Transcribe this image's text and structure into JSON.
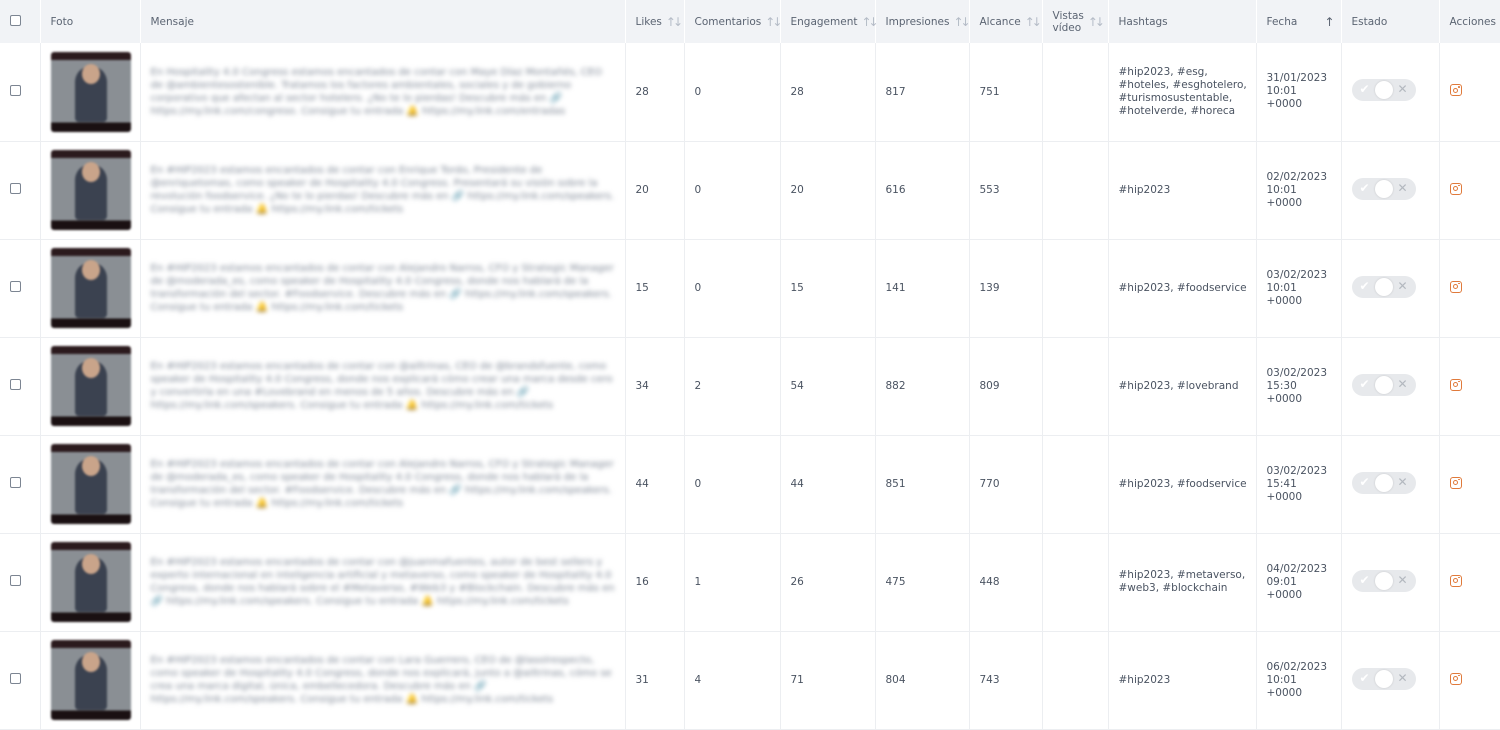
{
  "table": {
    "headers": {
      "foto": "Foto",
      "mensaje": "Mensaje",
      "likes": "Likes",
      "comentarios": "Comentarios",
      "engagement": "Engagement",
      "impresiones": "Impresiones",
      "alcance": "Alcance",
      "vistas_video": "Vistas vídeo",
      "hashtags": "Hashtags",
      "fecha": "Fecha",
      "estado": "Estado",
      "acciones": "Acciones"
    },
    "sort_icon": "↑↓",
    "sort_active_icon": "↑↓",
    "rows": [
      {
        "message": "En Hospitality 4.0 Congress estamos encantados de contar con Maye Díaz Montañés, CEO de @ambientesostenible. Tratamos los factores ambientales, sociales y de gobierno corporativo que afectan al sector hotelero. ¿No te lo pierdas! Descubre más en 🔗 https://my.link.com/congreso. Consigue tu entrada 🔔 https://my.link.com/entradas",
        "likes": "28",
        "comentarios": "0",
        "engagement": "28",
        "impresiones": "817",
        "alcance": "751",
        "vistas_video": "",
        "hashtags": "#hip2023, #esg, #hoteles, #esghotelero, #turismosustentable, #hotelverde, #horeca",
        "fecha": "31/01/2023 10:01 +0000"
      },
      {
        "message": "En #HIP2023 estamos encantados de contar con Enrique Tordo, Presidente de @enriquetomas, como speaker de Hospitality 4.0 Congress. Presentará su visión sobre la revolución foodservice. ¿No te lo pierdas! Descubre más en 🔗 https://my.link.com/speakers. Consigue tu entrada 🔔 https://my.link.com/tickets",
        "likes": "20",
        "comentarios": "0",
        "engagement": "20",
        "impresiones": "616",
        "alcance": "553",
        "vistas_video": "",
        "hashtags": "#hip2023",
        "fecha": "02/02/2023 10:01 +0000"
      },
      {
        "message": "En #HIP2023 estamos encantados de contar con Alejandro Narros, CFO y Strategic Manager de @moderada_es, como speaker de Hospitality 4.0 Congress, donde nos hablará de la transformación del sector. #Foodservice. Descubre más en 🔗 https://my.link.com/speakers. Consigue tu entrada 🔔 https://my.link.com/tickets",
        "likes": "15",
        "comentarios": "0",
        "engagement": "15",
        "impresiones": "141",
        "alcance": "139",
        "vistas_video": "",
        "hashtags": "#hip2023, #foodservice",
        "fecha": "03/02/2023 10:01 +0000"
      },
      {
        "message": "En #HIP2023 estamos encantados de contar con @ailtrinas, CEO de @brandsfuente, como speaker de Hospitality 4.0 Congress, donde nos explicará cómo crear una marca desde cero y convertirla en una #Lovebrand en menos de 5 años. Descubre más en 🔗 https://my.link.com/speakers. Consigue tu entrada 🔔 https://my.link.com/tickets",
        "likes": "34",
        "comentarios": "2",
        "engagement": "54",
        "impresiones": "882",
        "alcance": "809",
        "vistas_video": "",
        "hashtags": "#hip2023, #lovebrand",
        "fecha": "03/02/2023 15:30 +0000"
      },
      {
        "message": "En #HIP2023 estamos encantados de contar con Alejandro Narros, CFO y Strategic Manager de @moderada_es, como speaker de Hospitality 4.0 Congress, donde nos hablará de la transformación del sector. #Foodservice. Descubre más en 🔗 https://my.link.com/speakers. Consigue tu entrada 🔔 https://my.link.com/tickets",
        "likes": "44",
        "comentarios": "0",
        "engagement": "44",
        "impresiones": "851",
        "alcance": "770",
        "vistas_video": "",
        "hashtags": "#hip2023, #foodservice",
        "fecha": "03/02/2023 15:41 +0000"
      },
      {
        "message": "En #HIP2023 estamos encantados de contar con @juanmafuentes, autor de best sellers y experto internacional en inteligencia artificial y metaverso, como speaker de Hospitality 4.0 Congress, donde nos hablará sobre el #Metaverso, #Web3 y #Blockchain. Descubre más en 🔗 https://my.link.com/speakers. Consigue tu entrada 🔔 https://my.link.com/tickets",
        "likes": "16",
        "comentarios": "1",
        "engagement": "26",
        "impresiones": "475",
        "alcance": "448",
        "vistas_video": "",
        "hashtags": "#hip2023, #metaverso, #web3, #blockchain",
        "fecha": "04/02/2023 09:01 +0000"
      },
      {
        "message": "En #HIP2023 estamos encantados de contar con Lara Guerrero, CEO de @lasolrespecto, como speaker de Hospitality 4.0 Congress, donde nos explicará, junto a @ailtrinas, cómo se crea una marca digital, única, embellecedora. Descubre más en 🔗 https://my.link.com/speakers. Consigue tu entrada 🔔 https://my.link.com/tickets",
        "likes": "31",
        "comentarios": "4",
        "engagement": "71",
        "impresiones": "804",
        "alcance": "743",
        "vistas_video": "",
        "hashtags": "#hip2023",
        "fecha": "06/02/2023 10:01 +0000"
      }
    ]
  },
  "icons": {
    "toggle_on": "✔",
    "toggle_off": "✕",
    "accent": "#e07a3b"
  }
}
